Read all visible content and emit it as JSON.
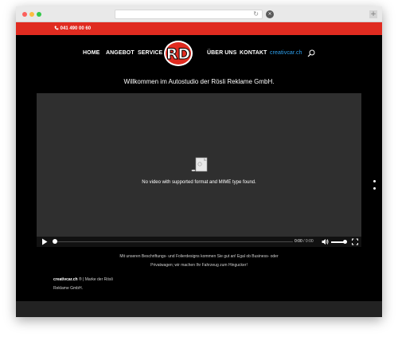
{
  "browser": {
    "reload_glyph": "↻",
    "stop_glyph": "×",
    "new_tab_glyph": "+"
  },
  "topbar": {
    "phone_icon": "phone-icon",
    "phone": "041 490 00 60"
  },
  "nav": {
    "home": "HOME",
    "angebot": "ANGEBOT",
    "service": "SERVICE",
    "ueber_uns": "ÜBER UNS",
    "kontakt": "KONTAKT",
    "creativcar": "creativcar.ch",
    "search_icon": "search-icon"
  },
  "logo": {
    "letters": "RD"
  },
  "welcome": "Willkommen im Autostudio der Rösli Reklame GmbH.",
  "video": {
    "message": "No video with supported format and MIME type found.",
    "current_time": "0:00",
    "separator": "/",
    "duration": "0:00",
    "progress": 0,
    "volume": 0.8
  },
  "intro": {
    "line1": "Mit unseren Beschriftungs- und Folierdesigns kommen Sie gut an! Egal ob Business- oder",
    "line2": "Privatwagen; wir machen Ihr Fahrzeug zum Hingucker!"
  },
  "footer": {
    "brand": "creativcar.ch",
    "line1_rest": " ® | Marke der Rösli",
    "line2": "Reklame GmbH."
  },
  "colors": {
    "accent_red": "#e02b20",
    "link_blue": "#2ea3f2"
  }
}
